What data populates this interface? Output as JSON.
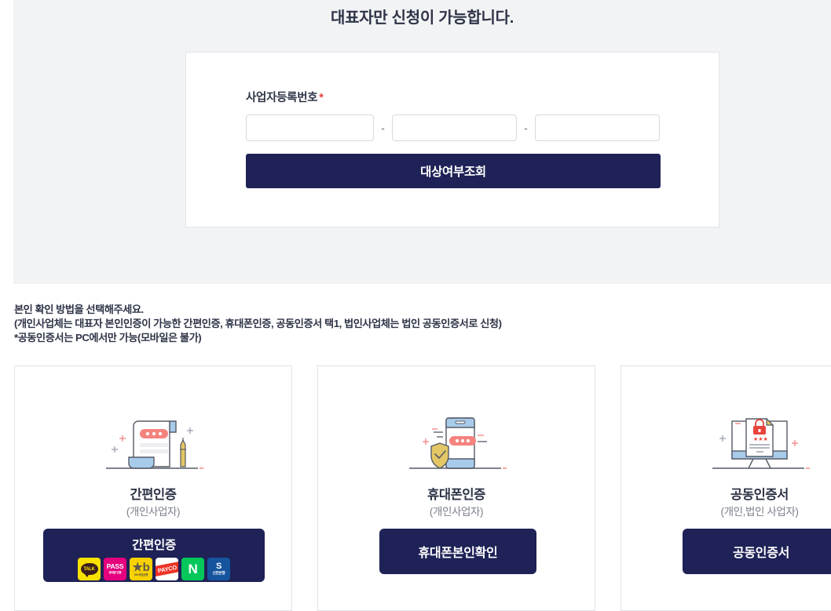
{
  "panel": {
    "title": "대표자만 신청이 가능합니다."
  },
  "form": {
    "label": "사업자등록번호",
    "required_mark": "*",
    "separator": "-",
    "segments": [
      {
        "name": "biz-no-part1",
        "value": "",
        "placeholder": ""
      },
      {
        "name": "biz-no-part2",
        "value": "",
        "placeholder": ""
      },
      {
        "name": "biz-no-part3",
        "value": "",
        "placeholder": ""
      }
    ],
    "submit_label": "대상여부조회"
  },
  "instructions": {
    "line1": "본인 확인 방법을 선택해주세요.",
    "line2": "(개인사업체는 대표자 본인인증이 가능한 간편인증, 휴대폰인증, 공동인증서 택1, 법인사업체는 법인 공동인증서로 신청)",
    "line3": "*공동인증서는 PC에서만 가능(모바일은 불가)"
  },
  "cards": [
    {
      "id": "simple-auth",
      "illustration": "document-with-pen-icon",
      "title": "간편인증",
      "subtitle": "(개인사업자)",
      "button_label": "간편인증",
      "providers": [
        {
          "name": "kakaotalk-logo",
          "label": "TALK",
          "sub": ""
        },
        {
          "name": "pass-logo",
          "label": "PASS",
          "sub": "휴대폰 인증"
        },
        {
          "name": "kb-logo",
          "label": "★b",
          "sub": "KB 국민은행"
        },
        {
          "name": "payco-logo",
          "label": "PAYCO",
          "sub": ""
        },
        {
          "name": "naver-logo",
          "label": "N",
          "sub": ""
        },
        {
          "name": "shinhan-logo",
          "label": "S",
          "sub": "신한은행"
        }
      ]
    },
    {
      "id": "mobile-auth",
      "illustration": "phone-with-shield-icon",
      "title": "휴대폰인증",
      "subtitle": "(개인사업자)",
      "button_label": "휴대폰본인확인",
      "providers": []
    },
    {
      "id": "joint-certificate",
      "illustration": "monitor-with-certificate-icon",
      "title": "공동인증서",
      "subtitle": "(개인,법인 사업자)",
      "button_label": "공동인증서",
      "providers": []
    }
  ],
  "colors": {
    "navy": "#1f2257",
    "panel_bg": "#f2f3f5",
    "required_red": "#e8453c",
    "card_border": "#e3e4e8",
    "subtitle_gray": "#7a7f8c",
    "illus_blue": "#a8cbea",
    "illus_pink": "#f4837f",
    "illus_yellow": "#e3c765"
  }
}
